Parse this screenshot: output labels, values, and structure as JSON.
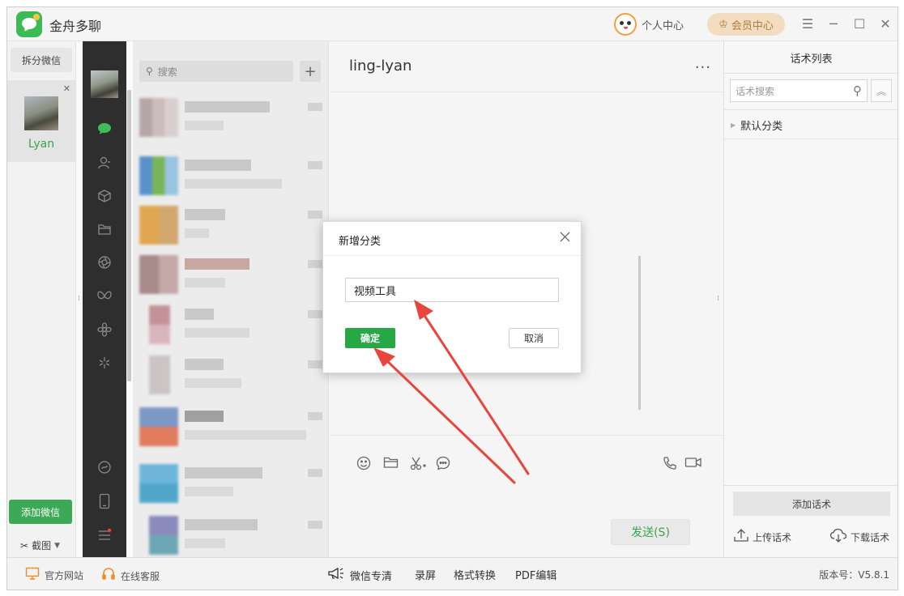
{
  "titlebar": {
    "app_title": "金舟多聊",
    "personal_center": "个人中心",
    "vip_center": "会员中心",
    "controls": [
      "menu-icon",
      "minimize-icon",
      "maximize-icon",
      "close-icon"
    ]
  },
  "accounts": {
    "split_label": "拆分微信",
    "active_account": "Lyan",
    "add_label": "添加微信",
    "screenshot_label": "截图"
  },
  "nav": {
    "icons": [
      "chat-icon",
      "contacts-icon",
      "cube-icon",
      "folder-icon",
      "moments-icon",
      "butterfly-icon",
      "flower-icon",
      "sparkle-icon"
    ],
    "bottom_icons": [
      "mini-program-icon",
      "phone-icon",
      "menu-icon"
    ]
  },
  "chat_list": {
    "search_placeholder": "搜索",
    "add_symbol": "+"
  },
  "chat": {
    "title": "ling-lyan",
    "more": "···",
    "tools": [
      "emoji-icon",
      "folder-icon",
      "scissors-icon",
      "chat-bubble-icon",
      "phone-call-icon",
      "video-call-icon"
    ],
    "send_label": "发送(S)"
  },
  "right_panel": {
    "title": "话术列表",
    "search_placeholder": "话术搜索",
    "category": "默认分类",
    "add_label": "添加话术",
    "upload_label": "上传话术",
    "download_label": "下载话术"
  },
  "statusbar": {
    "website": "官方网站",
    "online_service": "在线客服",
    "wechat_clean": "微信专清",
    "record_screen": "录屏",
    "format_convert": "格式转换",
    "pdf_edit": "PDF编辑",
    "version": "版本号：V5.8.1"
  },
  "modal": {
    "title": "新增分类",
    "input_value": "视频工具",
    "ok_label": "确定",
    "cancel_label": "取消"
  },
  "colors": {
    "accent_green": "#28a745",
    "nav_dark": "#2e2e2e",
    "arrow_red": "#e8453c",
    "vip_bg": "#f3ddc1"
  }
}
